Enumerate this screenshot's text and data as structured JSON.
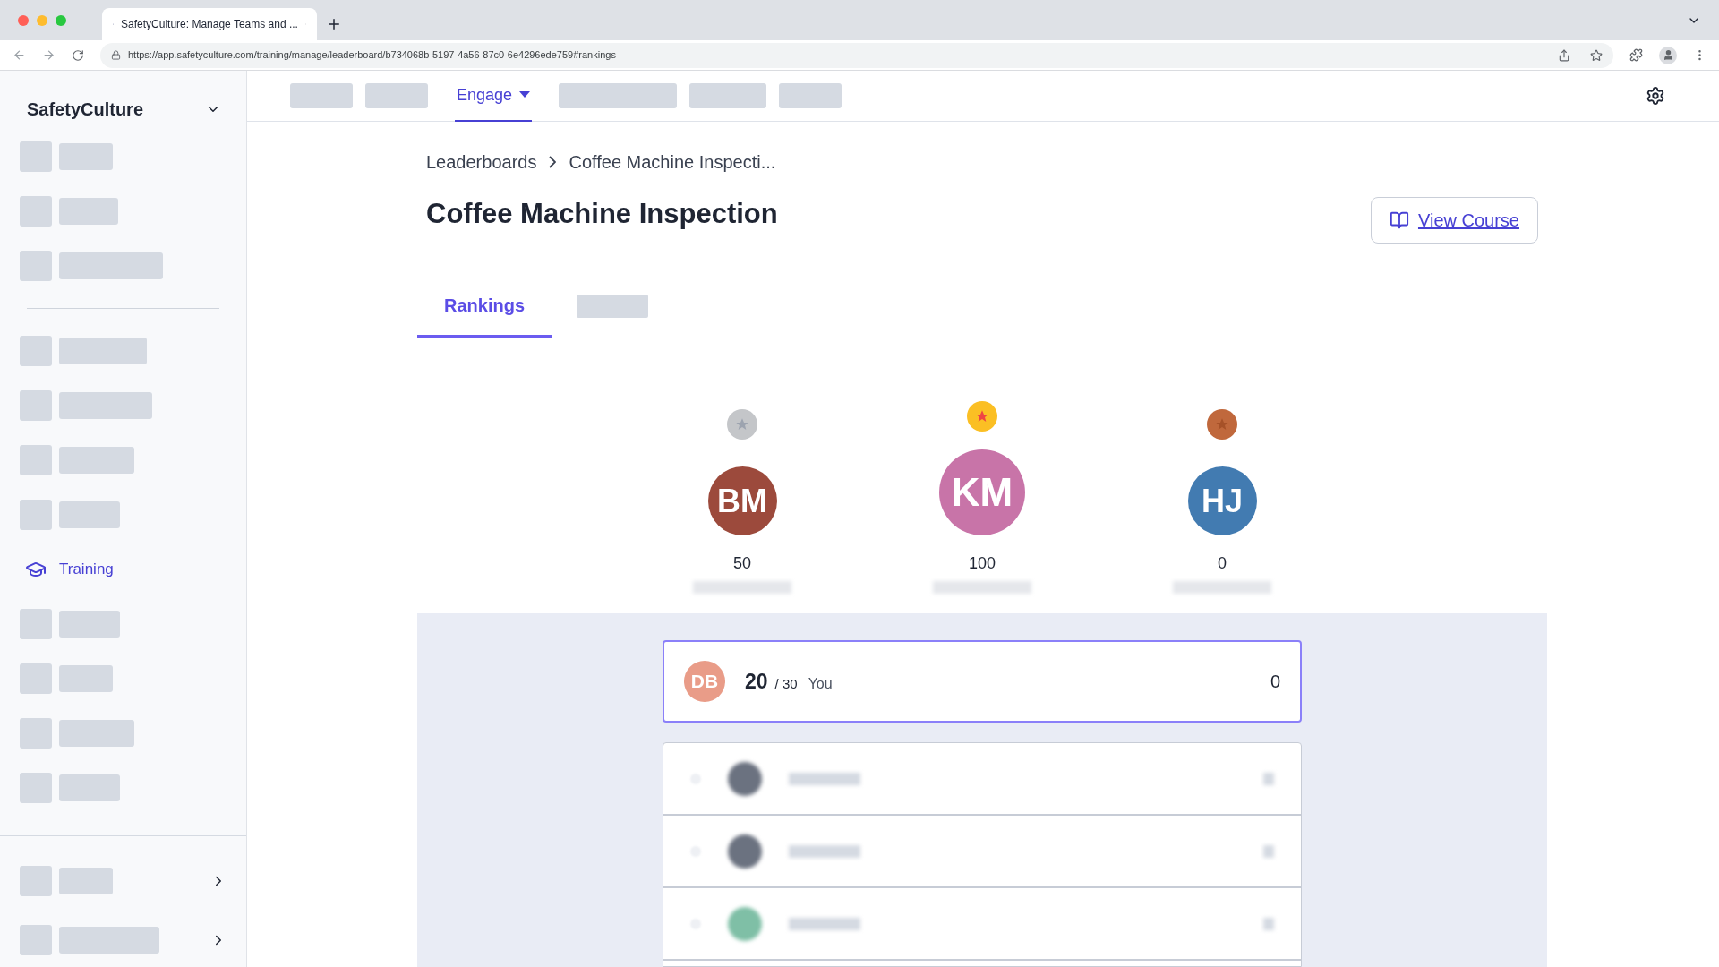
{
  "browser": {
    "tab_title": "SafetyCulture: Manage Teams and ...",
    "url": "https://app.safetyculture.com/training/manage/leaderboard/b734068b-5197-4a56-87c0-6e4296ede759#rankings"
  },
  "sidebar": {
    "brand": "SafetyCulture",
    "items": [
      {
        "kind": "placeholder"
      },
      {
        "kind": "placeholder"
      },
      {
        "kind": "placeholder"
      },
      {
        "kind": "divider"
      },
      {
        "kind": "placeholder"
      },
      {
        "kind": "placeholder"
      },
      {
        "kind": "placeholder"
      },
      {
        "kind": "placeholder"
      },
      {
        "kind": "link",
        "label": "Training",
        "selected": true
      },
      {
        "kind": "placeholder"
      },
      {
        "kind": "placeholder"
      },
      {
        "kind": "placeholder"
      },
      {
        "kind": "placeholder"
      }
    ],
    "footer_items": [
      {
        "kind": "placeholder"
      },
      {
        "kind": "placeholder"
      }
    ]
  },
  "top_nav": {
    "items": [
      {
        "kind": "placeholder"
      },
      {
        "kind": "placeholder"
      },
      {
        "kind": "link",
        "label": "Engage",
        "selected": true
      },
      {
        "kind": "placeholder"
      },
      {
        "kind": "placeholder"
      },
      {
        "kind": "placeholder"
      }
    ]
  },
  "breadcrumb": [
    "Leaderboards",
    "Coffee Machine Inspecti..."
  ],
  "title": "Coffee Machine Inspection",
  "view_course": "View Course",
  "tabs": [
    {
      "kind": "link",
      "label": "Rankings",
      "selected": true
    },
    {
      "kind": "placeholder",
      "selected": false
    }
  ],
  "podium": [
    {
      "kind": "silver",
      "initials": "BM",
      "color": "#9c4a3c",
      "score": "50"
    },
    {
      "kind": "gold",
      "initials": "KM",
      "color": "#c874a8",
      "score": "100"
    },
    {
      "kind": "bronze",
      "initials": "HJ",
      "color": "#427bb1",
      "score": "0"
    }
  ],
  "you": {
    "initials": "DB",
    "color": "#e99c88",
    "score": "20",
    "total": "/ 30",
    "label": "You",
    "points": "0"
  },
  "others": [
    {
      "color": "#6b7280"
    },
    {
      "color": "#6b7280"
    },
    {
      "color": "#7fbfa6"
    }
  ]
}
